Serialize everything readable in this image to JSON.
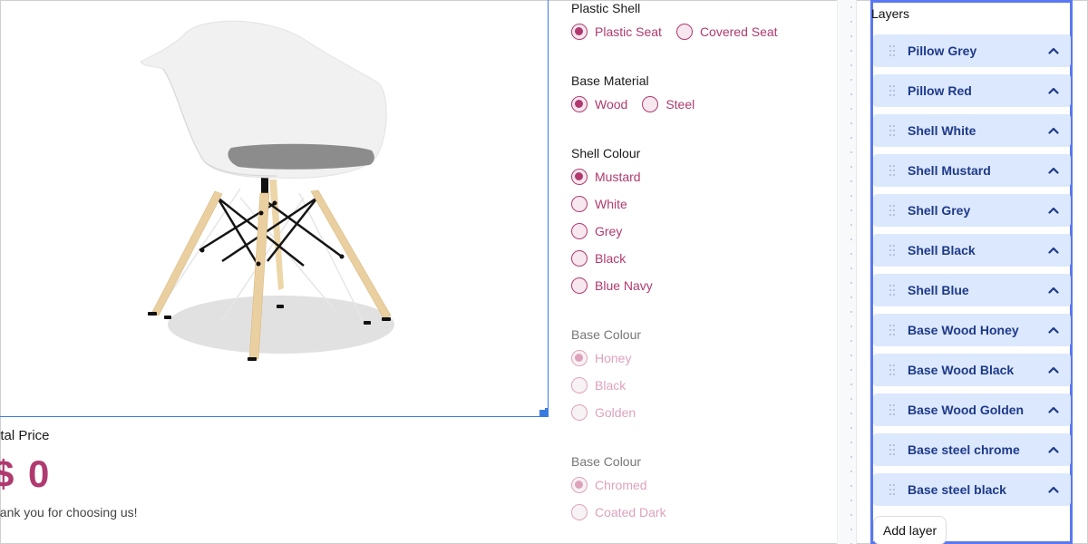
{
  "preview": {
    "image_alt": "White plastic armchair with grey seat pillow, honey wood legs and black steel wire base",
    "price_label": "otal Price",
    "price_value": "$ 0",
    "thanks": "hank you for choosing us!"
  },
  "options": {
    "groups": [
      {
        "title": "Plastic Shell",
        "layout": "inline",
        "disabled": false,
        "items": [
          {
            "label": "Plastic Seat",
            "checked": true
          },
          {
            "label": "Covered Seat",
            "checked": false
          }
        ]
      },
      {
        "title": "Base Material",
        "layout": "inline",
        "disabled": false,
        "items": [
          {
            "label": "Wood",
            "checked": true
          },
          {
            "label": "Steel",
            "checked": false
          }
        ]
      },
      {
        "title": "Shell Colour",
        "layout": "stacked",
        "disabled": false,
        "items": [
          {
            "label": "Mustard",
            "checked": true
          },
          {
            "label": "White",
            "checked": false
          },
          {
            "label": "Grey",
            "checked": false
          },
          {
            "label": "Black",
            "checked": false
          },
          {
            "label": "Blue Navy",
            "checked": false
          }
        ]
      },
      {
        "title": "Base Colour",
        "layout": "stacked",
        "disabled": true,
        "items": [
          {
            "label": "Honey",
            "checked": true
          },
          {
            "label": "Black",
            "checked": false
          },
          {
            "label": "Golden",
            "checked": false
          }
        ]
      },
      {
        "title": "Base Colour",
        "layout": "stacked",
        "disabled": true,
        "items": [
          {
            "label": "Chromed",
            "checked": true
          },
          {
            "label": "Coated Dark",
            "checked": false
          }
        ]
      }
    ]
  },
  "layers": {
    "title": "Layers",
    "items": [
      {
        "name": "Pillow Grey"
      },
      {
        "name": "Pillow Red"
      },
      {
        "name": "Shell White"
      },
      {
        "name": "Shell Mustard"
      },
      {
        "name": "Shell Grey"
      },
      {
        "name": "Shell Black"
      },
      {
        "name": "Shell Blue"
      },
      {
        "name": "Base Wood Honey"
      },
      {
        "name": "Base Wood Black"
      },
      {
        "name": "Base Wood Golden"
      },
      {
        "name": "Base steel chrome"
      },
      {
        "name": "Base steel black"
      }
    ],
    "add_label": "Add layer"
  },
  "colors": {
    "accent": "#b03a6f",
    "accent_disabled": "#dea2bd",
    "layer_bg": "#dce8fd",
    "layer_text": "#1e3a8a",
    "panel_border": "#5a78f0",
    "selection_border": "#3b7be0"
  }
}
